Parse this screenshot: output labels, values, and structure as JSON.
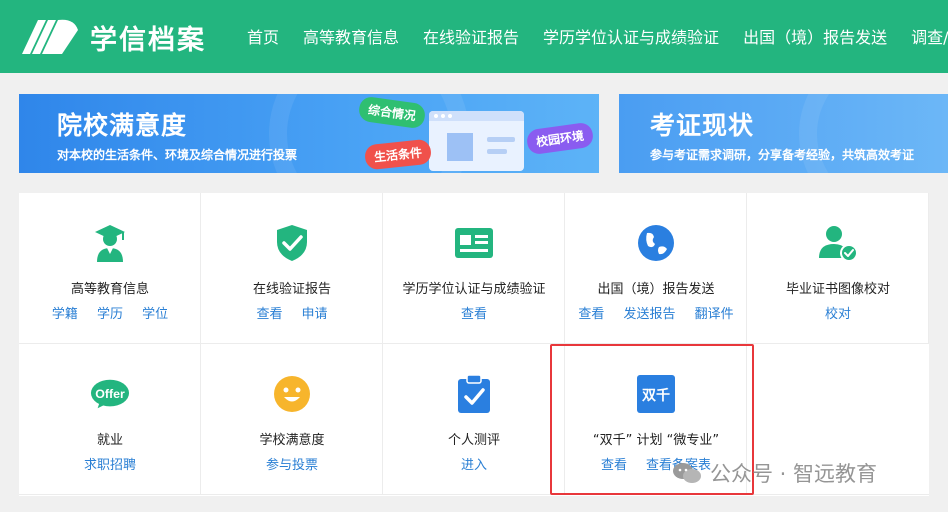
{
  "header": {
    "brand": "学信档案",
    "nav": [
      "首页",
      "高等教育信息",
      "在线验证报告",
      "学历学位认证与成绩验证",
      "出国（境）报告发送",
      "调查/"
    ]
  },
  "banners": [
    {
      "title": "院校满意度",
      "subtitle": "对本校的生活条件、环境及综合情况进行投票",
      "tags": [
        "综合情况",
        "生活条件",
        "校园环境"
      ]
    },
    {
      "title": "考证现状",
      "subtitle": "参与考证需求调研，分享备考经验，共筑高效考证"
    }
  ],
  "cards": [
    {
      "title": "高等教育信息",
      "icon": "graduate-icon",
      "links": [
        "学籍",
        "学历",
        "学位"
      ]
    },
    {
      "title": "在线验证报告",
      "icon": "shield-check-icon",
      "links": [
        "查看",
        "申请"
      ]
    },
    {
      "title": "学历学位认证与成绩验证",
      "icon": "id-card-icon",
      "links": [
        "查看"
      ]
    },
    {
      "title": "出国（境）报告发送",
      "icon": "globe-icon",
      "links": [
        "查看",
        "发送报告",
        "翻译件"
      ]
    },
    {
      "title": "毕业证书图像校对",
      "icon": "user-check-icon",
      "links": [
        "校对"
      ]
    },
    {
      "title": "就业",
      "icon": "offer-icon",
      "icon_text": "Offer",
      "links": [
        "求职招聘"
      ]
    },
    {
      "title": "学校满意度",
      "icon": "smiley-icon",
      "links": [
        "参与投票"
      ]
    },
    {
      "title": "个人测评",
      "icon": "clipboard-check-icon",
      "links": [
        "进入"
      ]
    },
    {
      "title": "“双千” 计划 “微专业”",
      "icon": "shuangqian-icon",
      "icon_text": "双千",
      "links": [
        "查看",
        "查看备案表"
      ]
    }
  ],
  "watermark": "公众号 · 智远教育",
  "colors": {
    "header": "#23b57f",
    "link": "#2a7fd4",
    "highlight": "#e8373b",
    "icon_green": "#23b57f",
    "icon_blue": "#2a7fe0"
  }
}
